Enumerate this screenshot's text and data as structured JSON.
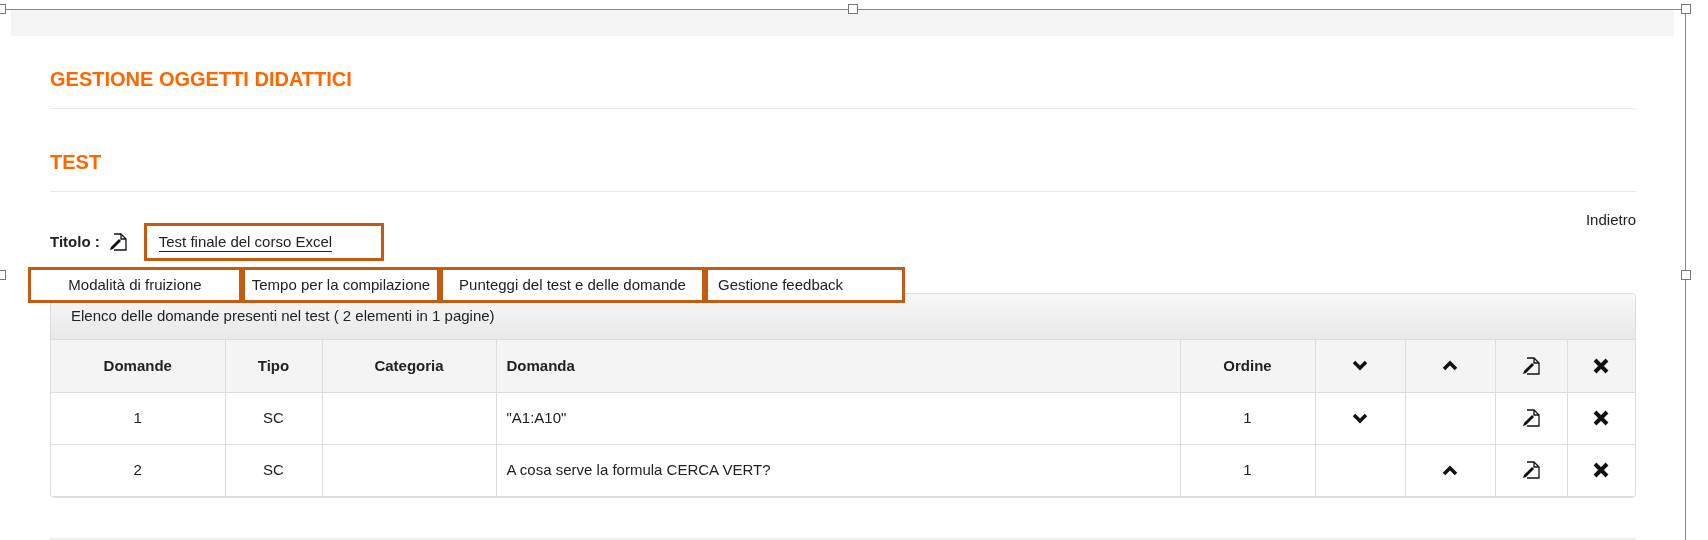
{
  "page_title": "GESTIONE OGGETTI DIDATTICI",
  "section_title": "TEST",
  "back_link": "Indietro",
  "title_field": {
    "label": "Titolo :",
    "value": "Test finale del corso Excel"
  },
  "tabs": [
    {
      "label": "Modalità di fruizione"
    },
    {
      "label": "Tempo per la compilazione"
    },
    {
      "label": "Punteggi del test e delle domande"
    },
    {
      "label": "Gestione feedback"
    }
  ],
  "table": {
    "caption": "Elenco delle domande presenti nel test ( 2 elementi in 1 pagine)",
    "columns": [
      "Domande",
      "Tipo",
      "Categoria",
      "Domanda",
      "Ordine"
    ],
    "rows": [
      {
        "number": "1",
        "type": "SC",
        "category": "",
        "question": "\"A1:A10\"",
        "order": "1",
        "can_move_down": true,
        "can_move_up": false
      },
      {
        "number": "2",
        "type": "SC",
        "category": "",
        "question": "A cosa serve la formula CERCA VERT?",
        "order": "1",
        "can_move_down": false,
        "can_move_up": true
      }
    ]
  }
}
